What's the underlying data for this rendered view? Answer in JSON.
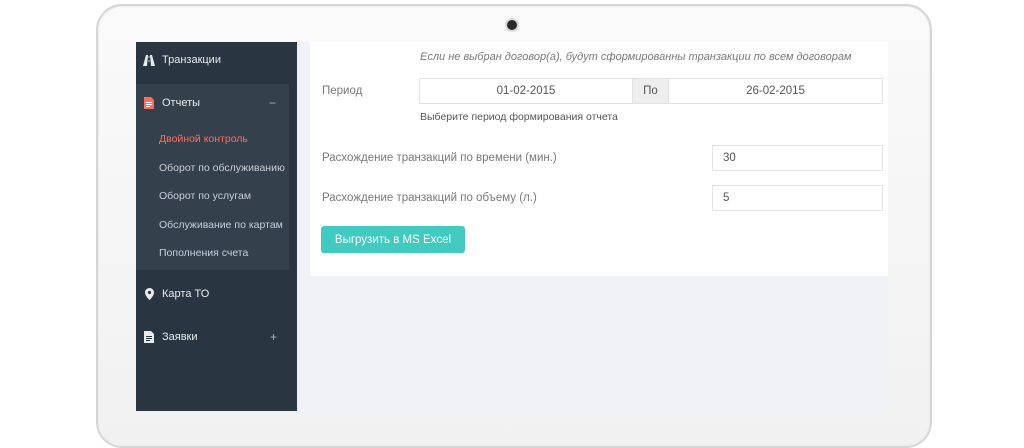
{
  "sidebar": {
    "transactions": "Транзакции",
    "reports": {
      "label": "Отчеты",
      "toggle": "−"
    },
    "report_items": [
      "Двойной контроль",
      "Оборот по обслуживанию",
      "Оборот по услугам",
      "Обслуживание по картам",
      "Пополнения счета"
    ],
    "active_item": "Двойной контроль",
    "map": "Карта ТО",
    "requests": {
      "label": "Заявки",
      "toggle": "+"
    }
  },
  "form": {
    "contract_hint": "Если не выбран договор(а), будут сформированны транзакции по всем договорам",
    "period_label": "Период",
    "date_from": "01-02-2015",
    "date_sep": "По",
    "date_to": "26-02-2015",
    "period_help": "Выберите период формирования отчета",
    "time_diff_label": "Расхождение транзакций по времени (мин.)",
    "time_diff_value": "30",
    "volume_diff_label": "Расхождение транзакций по объему (л.)",
    "volume_diff_value": "5",
    "export_button": "Выгрузить в MS Excel"
  },
  "colors": {
    "sidebar_bg": "#2a3542",
    "active_link": "#ff6c60",
    "button_bg": "#41cac0"
  },
  "icons": {
    "transactions": "road-icon",
    "reports": "file-icon",
    "map": "map-marker-icon",
    "requests": "document-icon"
  }
}
